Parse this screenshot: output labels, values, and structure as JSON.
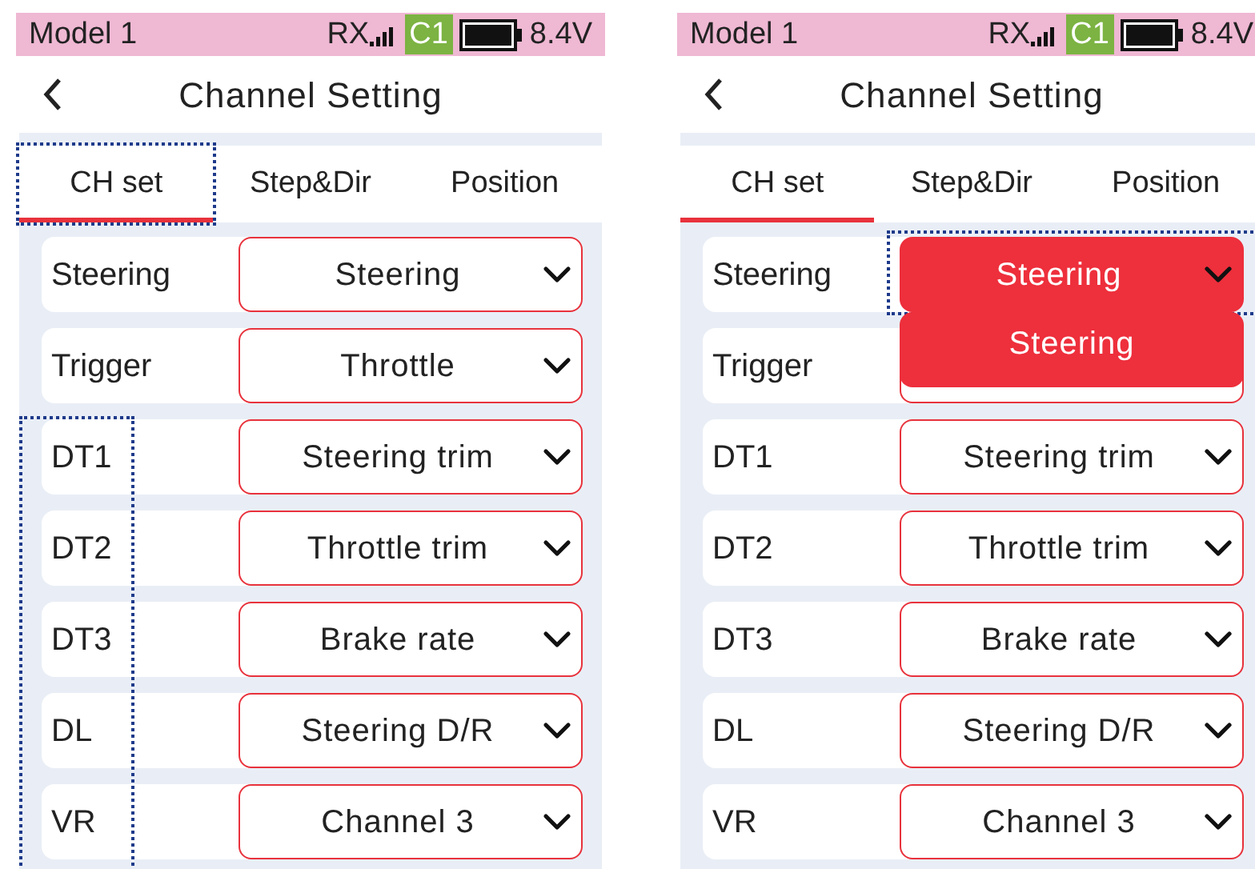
{
  "panels": [
    {
      "status": {
        "model": "Model 1",
        "rx": "RX",
        "channel": "C1",
        "voltage": "8.4V"
      },
      "title": "Channel Setting",
      "labels_focused": true,
      "tabs": [
        {
          "label": "CH set",
          "selected": true,
          "focused": true
        },
        {
          "label": "Step&Dir",
          "selected": false,
          "focused": false
        },
        {
          "label": "Position",
          "selected": false,
          "focused": false
        }
      ],
      "rows": [
        {
          "label": "Steering",
          "value": "Steering",
          "open": false,
          "focused": false
        },
        {
          "label": "Trigger",
          "value": "Throttle",
          "open": false,
          "focused": false
        },
        {
          "label": "DT1",
          "value": "Steering trim",
          "open": false,
          "focused": false
        },
        {
          "label": "DT2",
          "value": "Throttle trim",
          "open": false,
          "focused": false
        },
        {
          "label": "DT3",
          "value": "Brake rate",
          "open": false,
          "focused": false
        },
        {
          "label": "DL",
          "value": "Steering D/R",
          "open": false,
          "focused": false
        },
        {
          "label": "VR",
          "value": "Channel 3",
          "open": false,
          "focused": false
        }
      ]
    },
    {
      "status": {
        "model": "Model 1",
        "rx": "RX",
        "channel": "C1",
        "voltage": "8.4V"
      },
      "title": "Channel Setting",
      "labels_focused": false,
      "tabs": [
        {
          "label": "CH set",
          "selected": true,
          "focused": false
        },
        {
          "label": "Step&Dir",
          "selected": false,
          "focused": false
        },
        {
          "label": "Position",
          "selected": false,
          "focused": false
        }
      ],
      "rows": [
        {
          "label": "Steering",
          "value": "Steering",
          "open": true,
          "focused": true,
          "options": [
            "Steering"
          ]
        },
        {
          "label": "Trigger",
          "open": false,
          "focused": false
        },
        {
          "label": "DT1",
          "value": "Steering trim",
          "open": false,
          "focused": false
        },
        {
          "label": "DT2",
          "value": "Throttle trim",
          "open": false,
          "focused": false
        },
        {
          "label": "DT3",
          "value": "Brake rate",
          "open": false,
          "focused": false
        },
        {
          "label": "DL",
          "value": "Steering D/R",
          "open": false,
          "focused": false
        },
        {
          "label": "VR",
          "value": "Channel 3",
          "open": false,
          "focused": false
        }
      ]
    }
  ]
}
